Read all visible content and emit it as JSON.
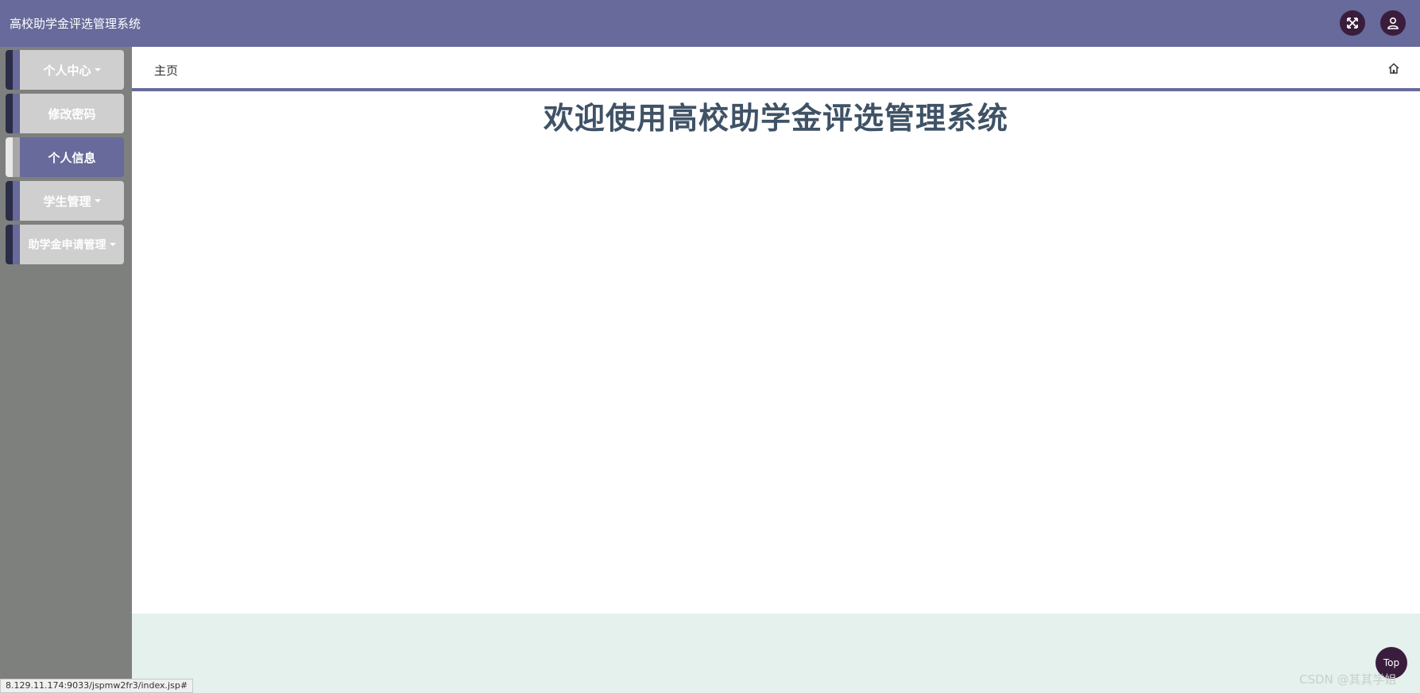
{
  "header": {
    "app_title": "高校助学金评选管理系统",
    "fullscreen_icon": "expand-arrows-icon",
    "user_icon": "user-icon"
  },
  "sidebar": {
    "items": [
      {
        "label": "个人中心",
        "has_dropdown": true,
        "active": false
      },
      {
        "label": "修改密码",
        "has_dropdown": false,
        "active": false
      },
      {
        "label": "个人信息",
        "has_dropdown": false,
        "active": true
      },
      {
        "label": "学生管理",
        "has_dropdown": true,
        "active": false
      },
      {
        "label": "助学金申请管理",
        "has_dropdown": true,
        "active": false
      }
    ]
  },
  "breadcrumb": {
    "current": "主页",
    "home_icon": "home-icon"
  },
  "main": {
    "welcome_title": "欢迎使用高校助学金评选管理系统"
  },
  "back_to_top": {
    "label": "Top"
  },
  "watermark": "CSDN @其其学姐",
  "status_bar": {
    "url": "8.129.11.174:9033/jspmw2fr3/index.jsp#"
  },
  "colors": {
    "header_bg": "#676a9a",
    "sidebar_bg": "#7e807d",
    "nav_item_bg": "#cfcfcf",
    "nav_item_active_bg": "#676a9a",
    "accent_dark": "#3a1d3c",
    "title_text": "#3f5266",
    "footer_band": "#e4f1ec"
  }
}
